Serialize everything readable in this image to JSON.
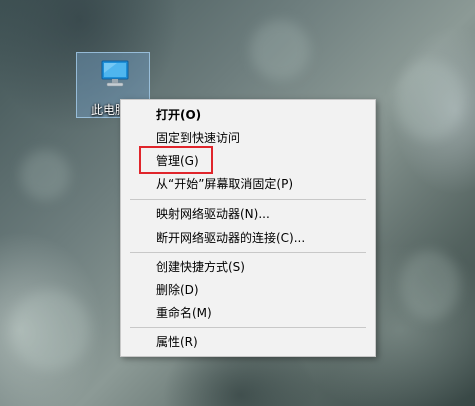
{
  "desktop": {
    "icon_label": "此电脑",
    "icon_name": "this-pc-icon"
  },
  "context_menu": {
    "items": [
      {
        "label": "打开(O)",
        "bold": true
      },
      {
        "label": "固定到快速访问"
      },
      {
        "label": "管理(G)",
        "highlighted": true
      },
      {
        "label": "从“开始”屏幕取消固定(P)"
      },
      {
        "label": "映射网络驱动器(N)..."
      },
      {
        "label": "断开网络驱动器的连接(C)..."
      },
      {
        "label": "创建快捷方式(S)"
      },
      {
        "label": "删除(D)"
      },
      {
        "label": "重命名(M)"
      },
      {
        "label": "属性(R)"
      }
    ]
  },
  "colors": {
    "menu_background": "#f2f2f2",
    "highlight_border": "#e0252b",
    "icon_selection": "#78aad7"
  }
}
